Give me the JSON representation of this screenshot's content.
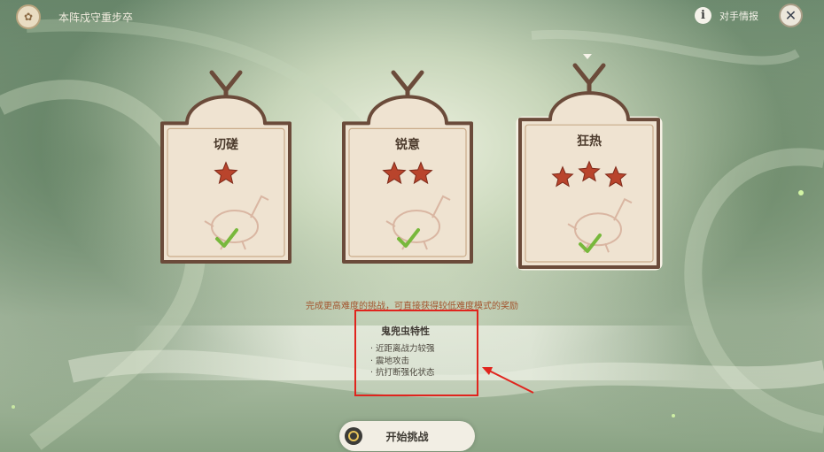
{
  "header": {
    "event_title": "本阵戍守重步卒",
    "opponent_info_label": "对手情报",
    "close_icon": "close-icon",
    "info_icon": "info-icon"
  },
  "difficulties": [
    {
      "name": "切磋",
      "stars": 1,
      "completed": true,
      "selected": false
    },
    {
      "name": "锐意",
      "stars": 2,
      "completed": true,
      "selected": false
    },
    {
      "name": "狂热",
      "stars": 3,
      "completed": true,
      "selected": true
    }
  ],
  "bonus_note": "完成更高难度的挑战，可直接获得较低难度模式的奖励",
  "traits": {
    "title": "鬼兜虫特性",
    "items": [
      "近距离战力较强",
      "震地攻击",
      "抗打断强化状态"
    ]
  },
  "start_button": {
    "label": "开始挑战"
  },
  "colors": {
    "star": "#b9442c",
    "check": "#78b83c",
    "card_frame": "#6b4b3a",
    "card_fill": "#efe3d1",
    "highlight": "#e0241d"
  }
}
